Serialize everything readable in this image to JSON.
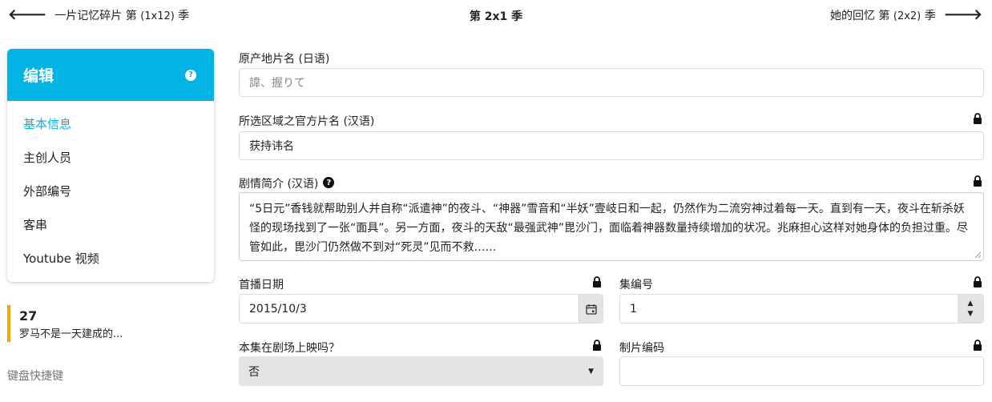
{
  "nav": {
    "prev_arrow": "🡐",
    "prev_title": "一片记忆碎片 第",
    "prev_code": "(1x12)",
    "prev_suffix": "季",
    "current_prefix": "第",
    "current_code": "2x1",
    "current_suffix": "季",
    "next_title": "她的回忆 第",
    "next_code": "(2x2)",
    "next_suffix": "季",
    "next_arrow": "🡒"
  },
  "sidebar": {
    "title": "编辑",
    "help_glyph": "?",
    "items": [
      {
        "label": "基本信息",
        "active": true
      },
      {
        "label": "主创人员",
        "active": false
      },
      {
        "label": "外部编号",
        "active": false
      },
      {
        "label": "客串",
        "active": false
      },
      {
        "label": "Youtube 视频",
        "active": false
      }
    ]
  },
  "episode": {
    "number": "27",
    "title": "罗马不是一天建成的..."
  },
  "shortcuts_label": "键盘快捷键",
  "form": {
    "original_name": {
      "label": "原产地片名 (日语)",
      "placeholder": "諱、握りて"
    },
    "official_name": {
      "label": "所选区域之官方片名 (汉语)",
      "value": "获持讳名"
    },
    "overview": {
      "label": "剧情简介 (汉语)",
      "value": "“5日元”香钱就帮助别人并自称“派遣神”的夜斗、“神器”雪音和“半妖”壹岐日和一起，仍然作为二流穷神过着每一天。直到有一天，夜斗在斩杀妖怪的现场找到了一张“面具”。另一方面，夜斗的天敌“最强武神”毘沙门，面临着神器数量持续增加的状况。兆麻担心这样对她身体的负担过重。尽管如此，毘沙门仍然做不到对“死灵”见而不救……"
    },
    "air_date": {
      "label": "首播日期",
      "value": "2015/10/3"
    },
    "episode_number": {
      "label": "集编号",
      "value": "1"
    },
    "theatrical": {
      "label": "本集在剧场上映吗？",
      "value": "否"
    },
    "production_code": {
      "label": "制片编码",
      "value": ""
    }
  },
  "colors": {
    "accent": "#01b4e4",
    "episode_bar": "#f5a60a"
  }
}
